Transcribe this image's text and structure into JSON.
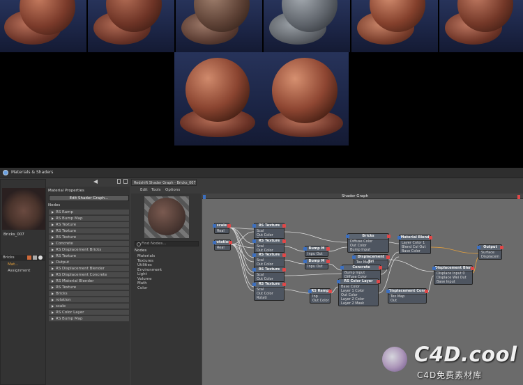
{
  "app": {
    "title": "Materials & Shaders"
  },
  "editor": {
    "title": "Redshift Shader Graph - Bricks_007",
    "menu": [
      "Edit",
      "Tools",
      "Options"
    ],
    "graph_title": "Shader Graph"
  },
  "materials": {
    "item_label": "Bricks",
    "material_name": "Bricks_007",
    "links": [
      "Mat...",
      "Assignment"
    ]
  },
  "properties": {
    "header": "Material Properties",
    "edit_button": "Edit Shader Graph...",
    "nodes_header": "Nodes",
    "nodes": [
      "RS Ramp",
      "RS Bump Map",
      "RS Texture",
      "RS Texture",
      "RS Texture",
      "Concrete",
      "RS Displacement Bricks",
      "RS Texture",
      "Output",
      "RS Displacement Blender",
      "RS Displacement Concrete",
      "RS Material Blender",
      "RS Texture",
      "Bricks",
      "rotation",
      "scale",
      "RS Color Layer",
      "RS Bump Map"
    ]
  },
  "node_browser": {
    "search_placeholder": "Find Nodes...",
    "header": "Nodes",
    "categories": [
      "Materials",
      "Textures",
      "Utilities",
      "Environment",
      "Light",
      "Volume",
      "Math",
      "Color"
    ]
  },
  "graph": {
    "nodes": [
      {
        "title": "scale",
        "rows": [
          "Real"
        ]
      },
      {
        "title": "rotation",
        "rows": [
          "Real"
        ]
      },
      {
        "title": "RS Texture",
        "rows": [
          "Scal",
          "Out Color",
          "Rotati"
        ]
      },
      {
        "title": "RS Texture",
        "rows": [
          "Scal",
          "Out Color",
          "Rotati"
        ]
      },
      {
        "title": "RS Texture",
        "rows": [
          "Scal",
          "Out Color",
          "Rotati"
        ]
      },
      {
        "title": "RS Texture",
        "rows": [
          "Scal",
          "Out Color",
          "Rotati"
        ]
      },
      {
        "title": "RS Texture",
        "rows": [
          "Scal",
          "Out Color",
          "Rotati"
        ]
      },
      {
        "title": "Bump M",
        "rows": [
          "Inpu Out"
        ]
      },
      {
        "title": "Bump M",
        "rows": [
          "Inpu Out"
        ]
      },
      {
        "title": "Bricks",
        "rows": [
          "Diffuse Color",
          "Out Color",
          "Bump Input"
        ]
      },
      {
        "title": "Displacement Bri",
        "rows": [
          "Tex Map",
          "Out"
        ]
      },
      {
        "title": "Concrete",
        "rows": [
          "Bump Input",
          "Diffuse Color",
          "Out Color"
        ]
      },
      {
        "title": "RS Color Layer",
        "rows": [
          "Base Color",
          "Layer 1 Color",
          "Out Color",
          "Layer 2 Color",
          "Layer 2 Mask"
        ]
      },
      {
        "title": "RS Ramp",
        "rows": [
          "Inp",
          "Out Color"
        ]
      },
      {
        "title": "Material Blend",
        "rows": [
          "Layer Color 1",
          "Blend Col Out",
          "Base Color"
        ]
      },
      {
        "title": "Displacement Blen",
        "rows": [
          "Displace Input 0",
          "Displace Wei Out",
          "Base Input"
        ]
      },
      {
        "title": "Displacement Conc",
        "rows": [
          "Tex Map",
          "Out"
        ]
      },
      {
        "title": "Output",
        "rows": [
          "Surface",
          "Displacem"
        ]
      }
    ]
  },
  "watermark": {
    "logo": "C4D.cool",
    "sub": "C4D免费素材库"
  }
}
